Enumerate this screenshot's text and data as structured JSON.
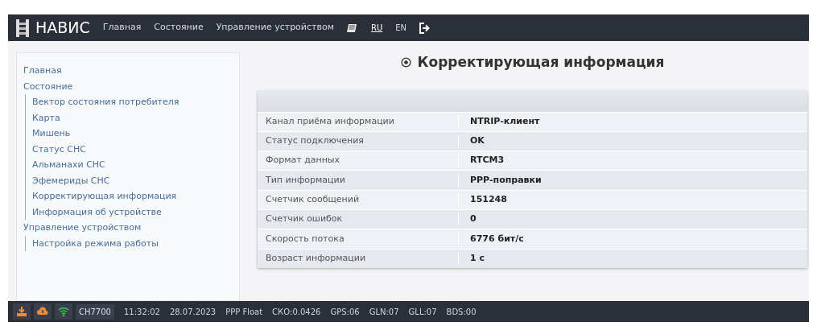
{
  "navbar": {
    "brand": "НАВИС",
    "links": [
      "Главная",
      "Состояние",
      "Управление устройством"
    ],
    "languages": [
      {
        "label": "RU",
        "selected": true
      },
      {
        "label": "EN",
        "selected": false
      }
    ]
  },
  "sidebar": {
    "items": [
      {
        "label": "Главная"
      },
      {
        "label": "Состояние",
        "children": [
          {
            "label": "Вектор состояния потребителя"
          },
          {
            "label": "Карта"
          },
          {
            "label": "Мишень"
          },
          {
            "label": "Статус СНС"
          },
          {
            "label": "Альманахи СНС"
          },
          {
            "label": "Эфемериды СНС"
          },
          {
            "label": "Корректирующая информация"
          },
          {
            "label": "Информация об устройстве"
          }
        ]
      },
      {
        "label": "Управление устройством",
        "children": [
          {
            "label": "Настройка режима работы"
          }
        ]
      }
    ]
  },
  "page_title": "Корректирующая информация",
  "table": {
    "rows": [
      {
        "label": "Канал приёма информации",
        "value": "NTRIP-клиент"
      },
      {
        "label": "Статус подключения",
        "value": "OK"
      },
      {
        "label": "Формат данных",
        "value": "RTCM3"
      },
      {
        "label": "Тип информации",
        "value": "PPP-поправки"
      },
      {
        "label": "Счетчик сообщений",
        "value": "151248"
      },
      {
        "label": "Счетчик ошибок",
        "value": "0"
      },
      {
        "label": "Скорость потока",
        "value": "6776 бит/с"
      },
      {
        "label": "Возраст информации",
        "value": "1 с"
      }
    ]
  },
  "status_bar": {
    "device": "CH7700",
    "items": [
      "11:32:02",
      "28.07.2023",
      "PPP Float",
      "СКО:0.0426",
      "GPS:06",
      "GLN:07",
      "GLL:07",
      "BDS:00"
    ]
  }
}
